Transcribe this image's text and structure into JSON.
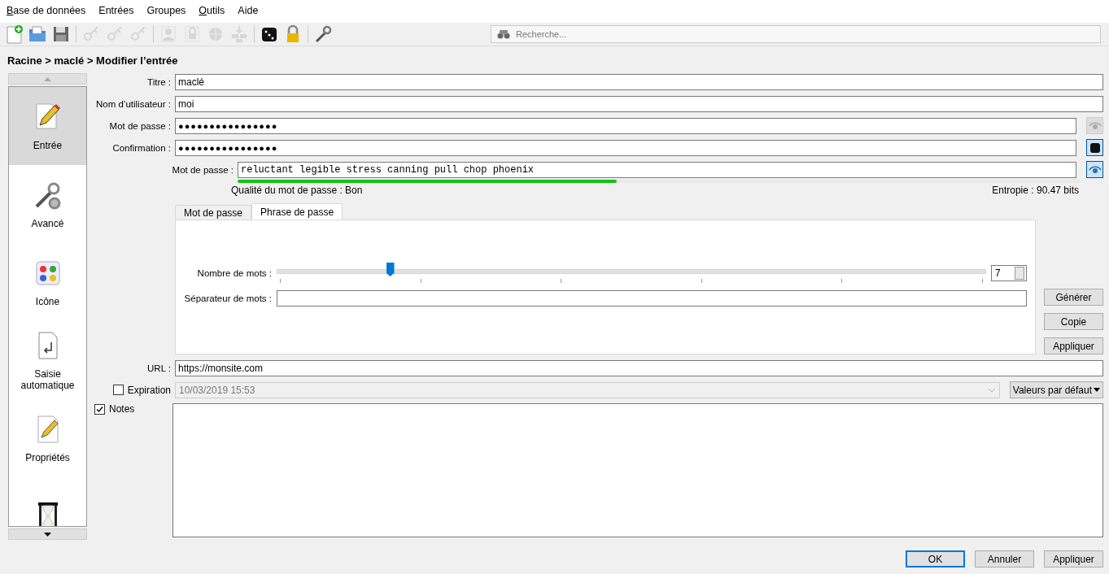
{
  "menu": [
    {
      "label": "Base de données",
      "mnemonic": true
    },
    {
      "label": "Entrées",
      "mnemonic": false
    },
    {
      "label": "Groupes",
      "mnemonic": false
    },
    {
      "label": "Outils",
      "mnemonic": true
    },
    {
      "label": "Aide",
      "mnemonic": false
    }
  ],
  "toolbar": [
    {
      "kind": "new",
      "disabled": false
    },
    {
      "kind": "open",
      "disabled": false
    },
    {
      "kind": "save",
      "disabled": false
    },
    {
      "kind": "sep"
    },
    {
      "kind": "key-add",
      "disabled": true
    },
    {
      "kind": "key-edit",
      "disabled": true
    },
    {
      "kind": "key-delete",
      "disabled": true
    },
    {
      "kind": "sep"
    },
    {
      "kind": "user",
      "disabled": true
    },
    {
      "kind": "lock-page",
      "disabled": true
    },
    {
      "kind": "globe",
      "disabled": true
    },
    {
      "kind": "autotype",
      "disabled": true
    },
    {
      "kind": "sep"
    },
    {
      "kind": "dice",
      "disabled": false
    },
    {
      "kind": "lock",
      "disabled": false
    },
    {
      "kind": "sep"
    },
    {
      "kind": "wrench",
      "disabled": false
    }
  ],
  "search": {
    "placeholder": "Recherche..."
  },
  "breadcrumb": "Racine > maclé > Modifier l’entrée",
  "sidebar": {
    "items": [
      {
        "label": "Entrée",
        "selected": true
      },
      {
        "label": "Avancé",
        "selected": false
      },
      {
        "label": "Icône",
        "selected": false
      },
      {
        "label": "Saisie automatique",
        "selected": false
      },
      {
        "label": "Propriétés",
        "selected": false
      },
      {
        "selected": false
      }
    ]
  },
  "form": {
    "title": {
      "label": "Titre :",
      "value": "maclé"
    },
    "username": {
      "label": "Nom d’utilisateur :",
      "value": "moi"
    },
    "password": {
      "label": "Mot de passe :",
      "value": "●●●●●●●●●●●●●●●●"
    },
    "confirm": {
      "label": "Confirmation :",
      "value": "●●●●●●●●●●●●●●●●"
    },
    "generator": {
      "label": "Mot de passe :",
      "value": "reluctant legible stress canning pull chop phoenix",
      "strength": {
        "level": 0.45
      },
      "quality": "Qualité du mot de passe : Bon",
      "entropy": "Entropie : 90.47 bits",
      "tabs": [
        {
          "label": "Mot de passe",
          "selected": false
        },
        {
          "label": "Phrase de passe",
          "selected": true
        }
      ],
      "word_count": {
        "label": "Nombre de mots :",
        "level": 0.16,
        "value": "7"
      },
      "separator": {
        "label": "Séparateur de mots :"
      },
      "buttons": [
        "Générer",
        "Copie",
        "Appliquer"
      ]
    },
    "url": {
      "label": "URL :",
      "value": "https://monsite.com"
    },
    "expiration": {
      "label": "Expiration",
      "checked": false,
      "value": "10/03/2019 15:53",
      "presets": "Valeurs par défaut"
    },
    "notes": {
      "label": "Notes",
      "checked": true
    }
  },
  "buttons": [
    {
      "label": "OK",
      "default": true
    },
    {
      "label": "Annuler",
      "default": false
    },
    {
      "label": "Appliquer",
      "default": false
    }
  ]
}
